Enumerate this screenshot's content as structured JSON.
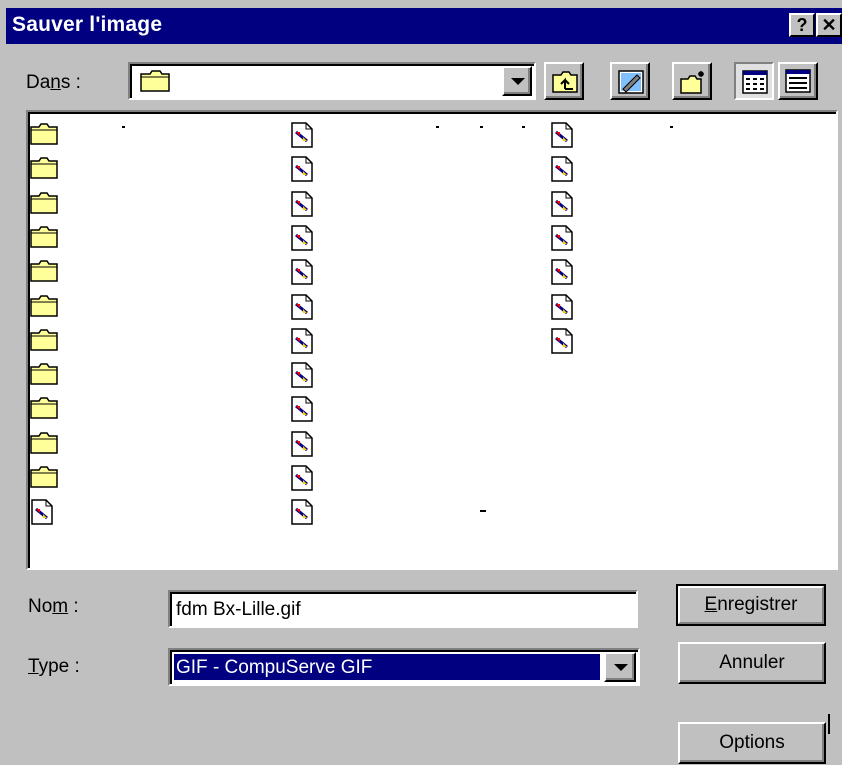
{
  "window": {
    "title": "Sauver l'image",
    "help_label": "?",
    "close_label": "✕"
  },
  "location": {
    "label_prefix": "Da",
    "label_mnemonic": "n",
    "label_suffix": "s :",
    "value": ""
  },
  "toolbar": {
    "icons": [
      "up-one-level-icon",
      "desktop-icon",
      "new-folder-icon",
      "list-view-icon",
      "details-view-icon"
    ]
  },
  "file_list": {
    "columns": [
      {
        "items": [
          "folder",
          "folder",
          "folder",
          "folder",
          "folder",
          "folder",
          "folder",
          "folder",
          "folder",
          "folder",
          "folder",
          "image"
        ]
      },
      {
        "items": [
          "image",
          "image",
          "image",
          "image",
          "image",
          "image",
          "image",
          "image",
          "image",
          "image",
          "image",
          "image"
        ]
      },
      {
        "items": [
          "image",
          "image",
          "image",
          "image",
          "image",
          "image",
          "image"
        ]
      }
    ]
  },
  "filename": {
    "label_prefix": "No",
    "label_mnemonic": "m",
    "label_suffix": " :",
    "value": "fdm Bx-Lille.gif"
  },
  "filetype": {
    "label_mnemonic": "T",
    "label_suffix": "ype :",
    "value": "GIF - CompuServe GIF"
  },
  "buttons": {
    "save_mnemonic": "E",
    "save_rest": "nregistrer",
    "cancel": "Annuler",
    "options": "Options"
  },
  "colors": {
    "titlebar": "#000080",
    "face": "#c0c0c0",
    "selection": "#000080",
    "folder": "#ffff99"
  }
}
